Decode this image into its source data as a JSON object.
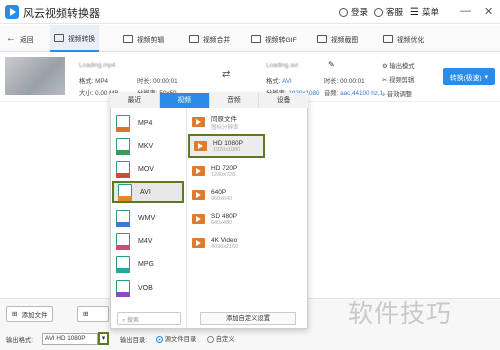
{
  "app": {
    "title": "风云视频转换器",
    "login": "登录",
    "support": "客服",
    "menu": "菜单"
  },
  "toolbar": {
    "back": "返回",
    "tabs": [
      {
        "label": "视频转换"
      },
      {
        "label": "视频剪辑"
      },
      {
        "label": "视频合并"
      },
      {
        "label": "视频转GIF"
      },
      {
        "label": "视频截图"
      },
      {
        "label": "视频优化"
      }
    ]
  },
  "file": {
    "name": "Loading.mp4",
    "format_label": "格式: MP4",
    "duration_label": "时长: 00:00:01",
    "size_label": "大小: 0.00 MB",
    "resolution_label": "分辨率: 50x50",
    "out_name": "Loading.avi",
    "out_format_label": "格式:",
    "out_format_value": "AVI",
    "out_duration_label": "时长: 00:00:01",
    "out_resolution_label": "分辨率:",
    "out_resolution_value": "1920x1080",
    "audio_label": "音频:",
    "audio_value": "aac,44100 hz,1...",
    "actions": [
      "输出模式",
      "视频剪辑",
      "音效调整"
    ]
  },
  "convert_button": "转换(极速)",
  "popup": {
    "tabs": [
      "最近",
      "视频",
      "音频",
      "设备"
    ],
    "active_tab": 1,
    "formats": [
      "MP4",
      "MKV",
      "MOV",
      "AVI",
      "WMV",
      "M4V",
      "MPG",
      "VOB"
    ],
    "selected_format": "AVI",
    "resolutions": [
      {
        "name": "同原文件",
        "sub": "图标分辨率"
      },
      {
        "name": "HD 1080P",
        "sub": "1920x1080"
      },
      {
        "name": "HD 720P",
        "sub": "1280x720"
      },
      {
        "name": "640P",
        "sub": "960x640"
      },
      {
        "name": "SD 480P",
        "sub": "640x480"
      },
      {
        "name": "4K Video",
        "sub": "4096x2160"
      }
    ],
    "selected_resolution": "HD 1080P",
    "search_placeholder": "搜索",
    "add_custom": "添加自定义设置"
  },
  "bottom": {
    "add_file": "添加文件",
    "output_format_label": "输出格式:",
    "output_format_value": "AVI HD 1080P",
    "output_dir_label": "输出目录:",
    "dir_options": [
      "源文件目录",
      "自定义"
    ]
  },
  "watermark": "软件技巧",
  "colors": {
    "accent": "#2a8be8",
    "highlight_border": "#5d7a22",
    "icon_orange": "#e07a2d"
  }
}
